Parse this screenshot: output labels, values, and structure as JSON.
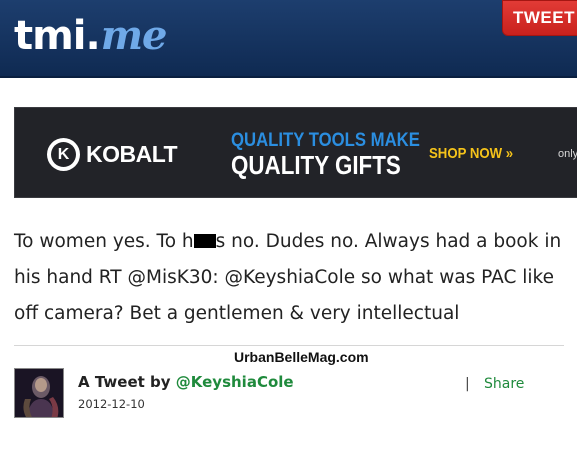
{
  "header": {
    "logo_main": "tmi",
    "logo_dot": ".",
    "logo_me": "me",
    "tweet_button": "TWEET"
  },
  "ad": {
    "brand": "KOBALT",
    "brand_icon_letter": "K",
    "line1": "QUALITY TOOLS MAKE",
    "line2": "QUALITY GIFTS",
    "cta": "SHOP NOW",
    "cta_arrow": "»",
    "only": "only"
  },
  "tweet": {
    "text_part1": "To women yes. To h",
    "text_part2": "s no. Dudes no. Always had a book in his hand RT @MisK30: @KeyshiaCole so what was PAC like off camera? Bet a gentlemen & very intellectual",
    "by_label": "A Tweet by",
    "handle": "@KeyshiaCole",
    "date": "2012-12-10",
    "separator": "|",
    "share_label": "Share"
  },
  "watermark": "UrbanBelleMag.com",
  "colors": {
    "header_bg": "#1d3e6e",
    "logo_accent": "#6fa9e8",
    "tweet_button": "#e23b36",
    "ad_accent_blue": "#2b8ee0",
    "ad_accent_yellow": "#f5c31a",
    "link_green": "#1f8a3c"
  }
}
